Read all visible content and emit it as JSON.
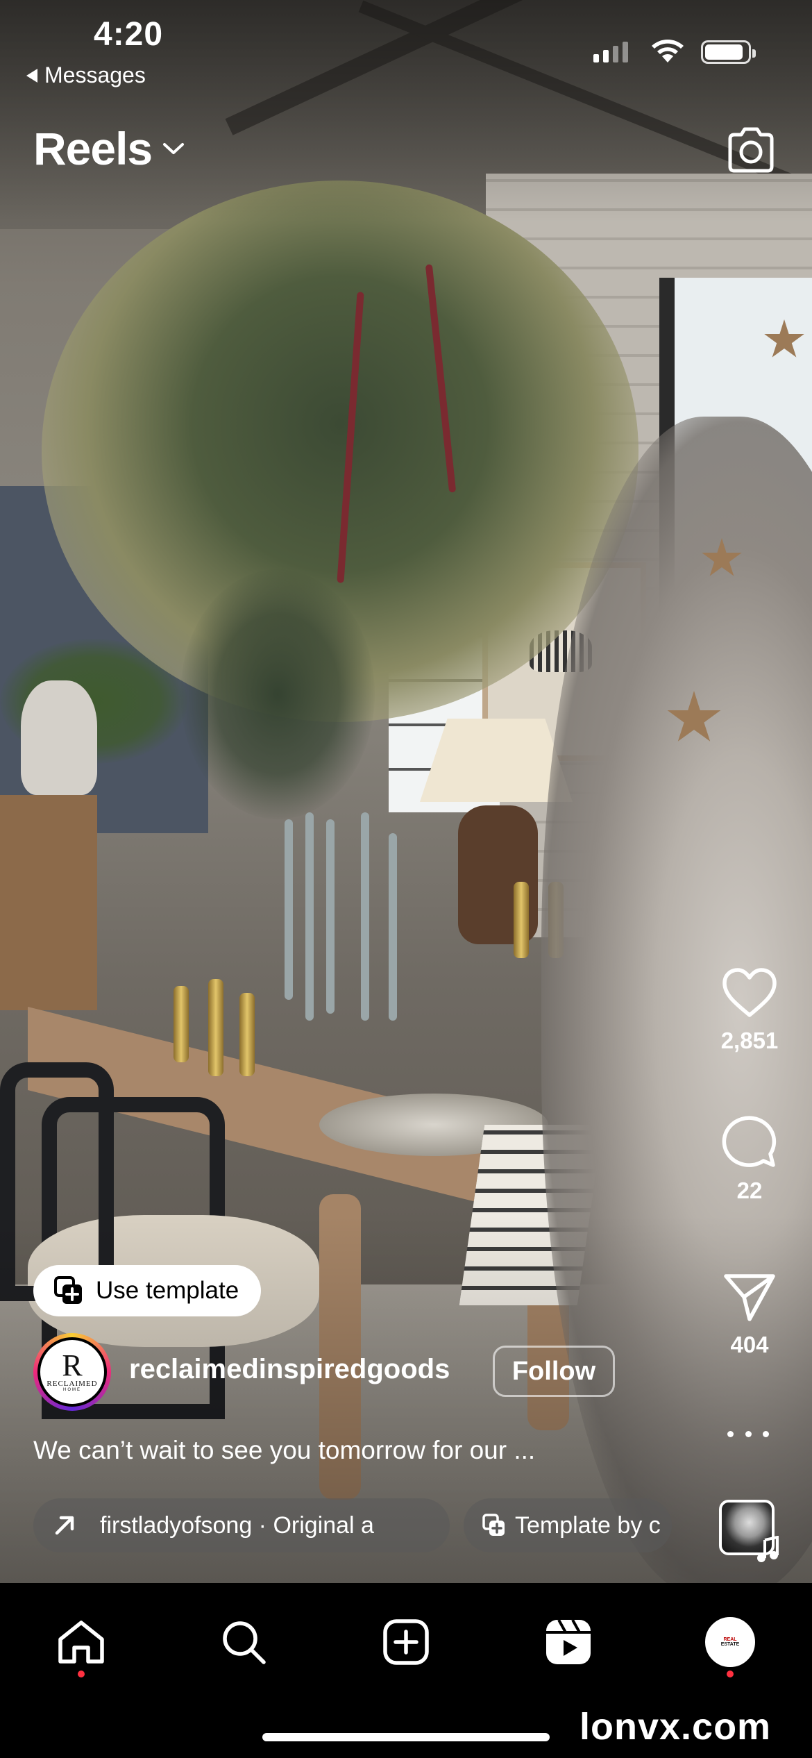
{
  "status_bar": {
    "time": "4:20",
    "back_label": "Messages"
  },
  "header": {
    "title": "Reels",
    "title_icon": "chevron-down-icon",
    "camera_icon": "camera-icon"
  },
  "actions": {
    "like_count": "2,851",
    "comment_count": "22",
    "share_count": "404",
    "more_icon": "more-horizontal-icon"
  },
  "post": {
    "use_template_label": "Use template",
    "avatar_text_big": "R",
    "avatar_text_small": "RECLAIMED",
    "avatar_text_tiny": "HOME",
    "username": "reclaimedinspiredgoods",
    "follow_label": "Follow",
    "caption": "We can’t wait to see you tomorrow for our ...",
    "audio_label": "firstladyofsong · Original a",
    "template_label": "Template by c"
  },
  "bottom_nav": {
    "items": [
      "home-icon",
      "search-icon",
      "create-icon",
      "reels-icon",
      "profile-avatar"
    ],
    "profile_line1": "REAL",
    "profile_line2": "ESTATE"
  },
  "watermark": "lonvx.com",
  "colors": {
    "notification_dot": "#ff3040",
    "story_ring_start": "#f9ce34",
    "story_ring_mid": "#ee2a7b",
    "story_ring_end": "#6228d7",
    "nav_background": "#000000"
  }
}
